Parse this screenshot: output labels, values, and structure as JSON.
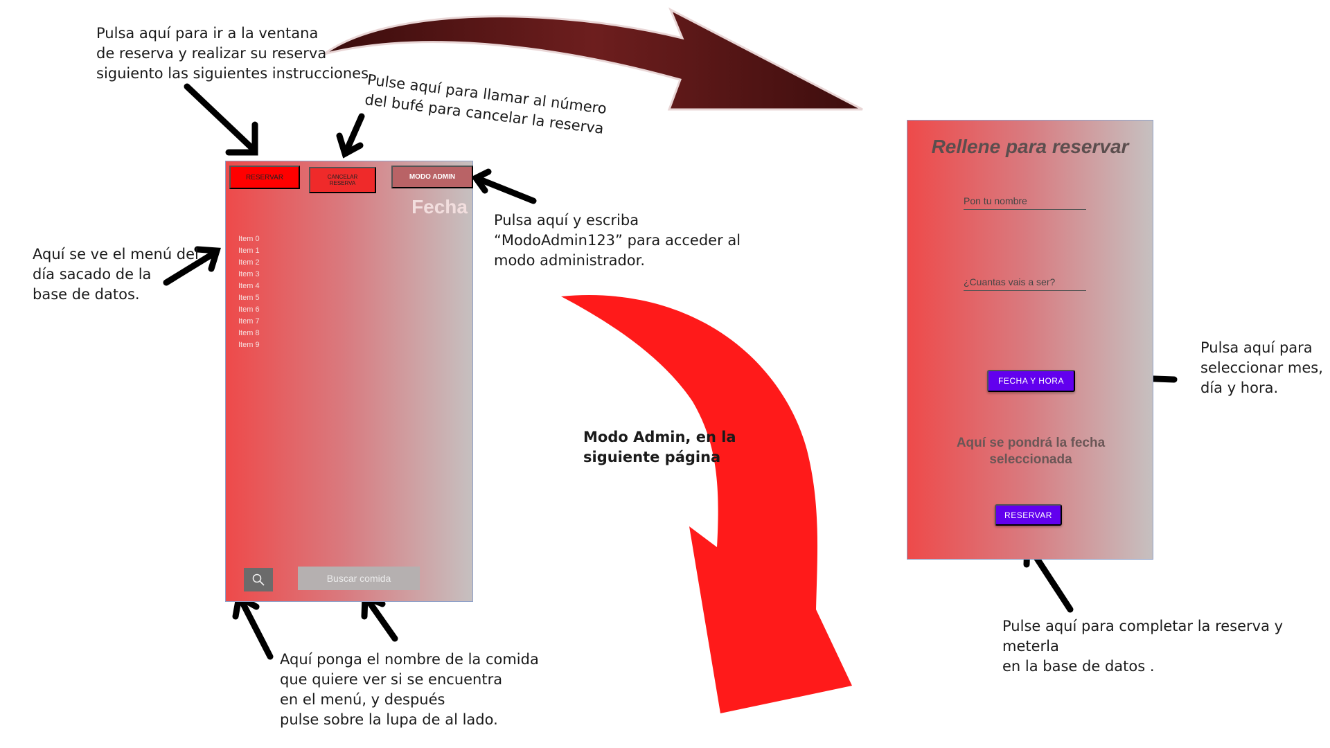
{
  "annotations": {
    "reservar_help": "Pulsa aquí para ir a la ventana\nde reserva y realizar su reserva\nsiguiento las siguientes instrucciones",
    "cancelar_help": "Pulse aquí para llamar al número\ndel bufé para cancelar la reserva",
    "admin_help": "Pulsa aquí y escriba\n“ModoAdmin123” para acceder al\nmodo administrador.",
    "menu_help": "Aquí se ve el menú del\ndía sacado de la\nbase de datos.",
    "search_help": "Aquí ponga el nombre de la comida\nque quiere ver si se encuentra\nen el menú, y después\npulse sobre la lupa de al lado.",
    "modo_admin_next": "Modo Admin, en la\nsiguiente página",
    "fecha_hora_help": "Pulsa aquí para\nseleccionar mes,\ndía y hora.",
    "reservar_submit_help": "Pulse aquí para completar la reserva y meterla\nen la base de datos ."
  },
  "main_screen": {
    "buttons": {
      "reservar": "RESERVAR",
      "cancelar_reserva": "CANCELAR RESERVA",
      "modo_admin": "MODO ADMIN"
    },
    "date_label": "Fecha",
    "menu_items": [
      "Item 0",
      "Item 1",
      "Item 2",
      "Item 3",
      "Item 4",
      "Item 5",
      "Item 6",
      "Item 7",
      "Item 8",
      "Item 9"
    ],
    "search_placeholder": "Buscar comida",
    "search_icon": "magnifier-icon"
  },
  "booking_screen": {
    "title": "Rellene para reservar",
    "name_placeholder": "Pon tu nombre",
    "people_placeholder": "¿Cuantas vais a ser?",
    "fecha_hora_button": "FECHA Y HORA",
    "selected_date_text": "Aquí se pondrá la fecha seleccionada",
    "reservar_button": "RESERVAR"
  },
  "colors": {
    "red_button": "#ff0000",
    "purple_button": "#6200ee",
    "big_arrow_red": "#ff1a1a",
    "big_arrow_dark": "#5a1414"
  }
}
